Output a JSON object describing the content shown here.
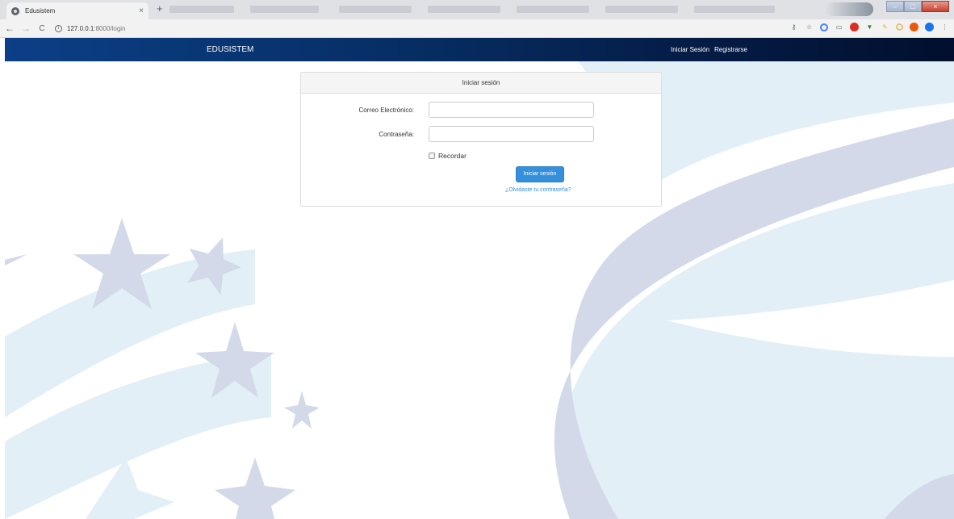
{
  "browser": {
    "tab": {
      "title": "Edusistem",
      "close_glyph": "×"
    },
    "new_tab_glyph": "+",
    "nav": {
      "back": "←",
      "forward": "→",
      "reload": "C"
    },
    "address_bar": {
      "host": "127.0.0.1",
      "path": ":8000/login"
    },
    "extension_icons": [
      "key-icon",
      "star-icon",
      "circle-g-icon",
      "cast-icon",
      "adblock-icon",
      "vue-devtools-icon",
      "pen-icon",
      "ring-icon",
      "stop-icon",
      "account-icon",
      "menu-icon"
    ]
  },
  "navbar": {
    "brand": "EDUSISTEM",
    "links": {
      "login": "Iniciar Sesión",
      "register": "Registrarse"
    },
    "colors": {
      "start": "#0b3f86",
      "end": "#020f2e"
    }
  },
  "login_panel": {
    "heading": "Iniciar sesión",
    "email": {
      "label": "Correo Electrónico:",
      "value": ""
    },
    "password": {
      "label": "Contraseña:",
      "value": ""
    },
    "remember_label": "Recordar",
    "remember_checked": false,
    "submit_label": "Iniciar sesión",
    "forgot_link": "¿Olvidaste tu contraseña?",
    "accent_color": "#3490dc"
  },
  "background": {
    "shape_color": "#d3d9e8",
    "light_color": "#e3eff7"
  }
}
